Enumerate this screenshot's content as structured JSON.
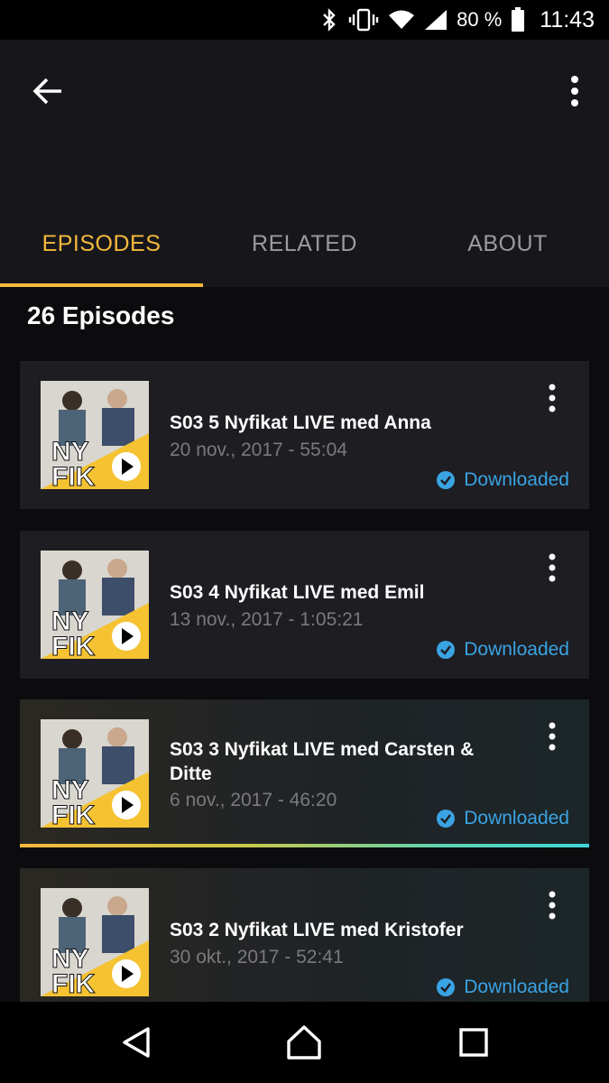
{
  "status_bar": {
    "icons": [
      "bluetooth-icon",
      "vibrate-icon",
      "wifi-icon",
      "signal-icon",
      "battery-icon"
    ],
    "battery": "80 %",
    "time": "11:43"
  },
  "app_bar": {
    "icons": [
      "back-arrow-icon",
      "more-vert-icon"
    ]
  },
  "tabs": [
    {
      "label": "EPISODES",
      "active": true
    },
    {
      "label": "RELATED",
      "active": false
    },
    {
      "label": "ABOUT",
      "active": false
    }
  ],
  "episode_count": "26 Episodes",
  "episodes": [
    {
      "title": "S03 5 Nyfikat LIVE med Anna",
      "meta": "20 nov., 2017 - 55:04",
      "status": "Downloaded",
      "progress": 0
    },
    {
      "title": "S03 4 Nyfikat LIVE med Emil",
      "meta": "13 nov., 2017 - 1:05:21",
      "status": "Downloaded",
      "progress": 0
    },
    {
      "title": "S03 3 Nyfikat LIVE med Carsten & Ditte",
      "meta": "6 nov., 2017 - 46:20",
      "status": "Downloaded",
      "progress": 1.0
    },
    {
      "title": "S03 2 Nyfikat LIVE med Kristofer",
      "meta": "30 okt., 2017 - 52:41",
      "status": "Downloaded",
      "progress": 0
    }
  ],
  "thumbnail_text": "NY FIK",
  "colors": {
    "accent": "#f5b93c",
    "downloaded": "#3aa3e3",
    "background": "#0c0c0f",
    "card": "#1d1d22"
  },
  "nav_bar": {
    "icons": [
      "back-triangle-icon",
      "home-icon",
      "recents-square-icon"
    ]
  }
}
